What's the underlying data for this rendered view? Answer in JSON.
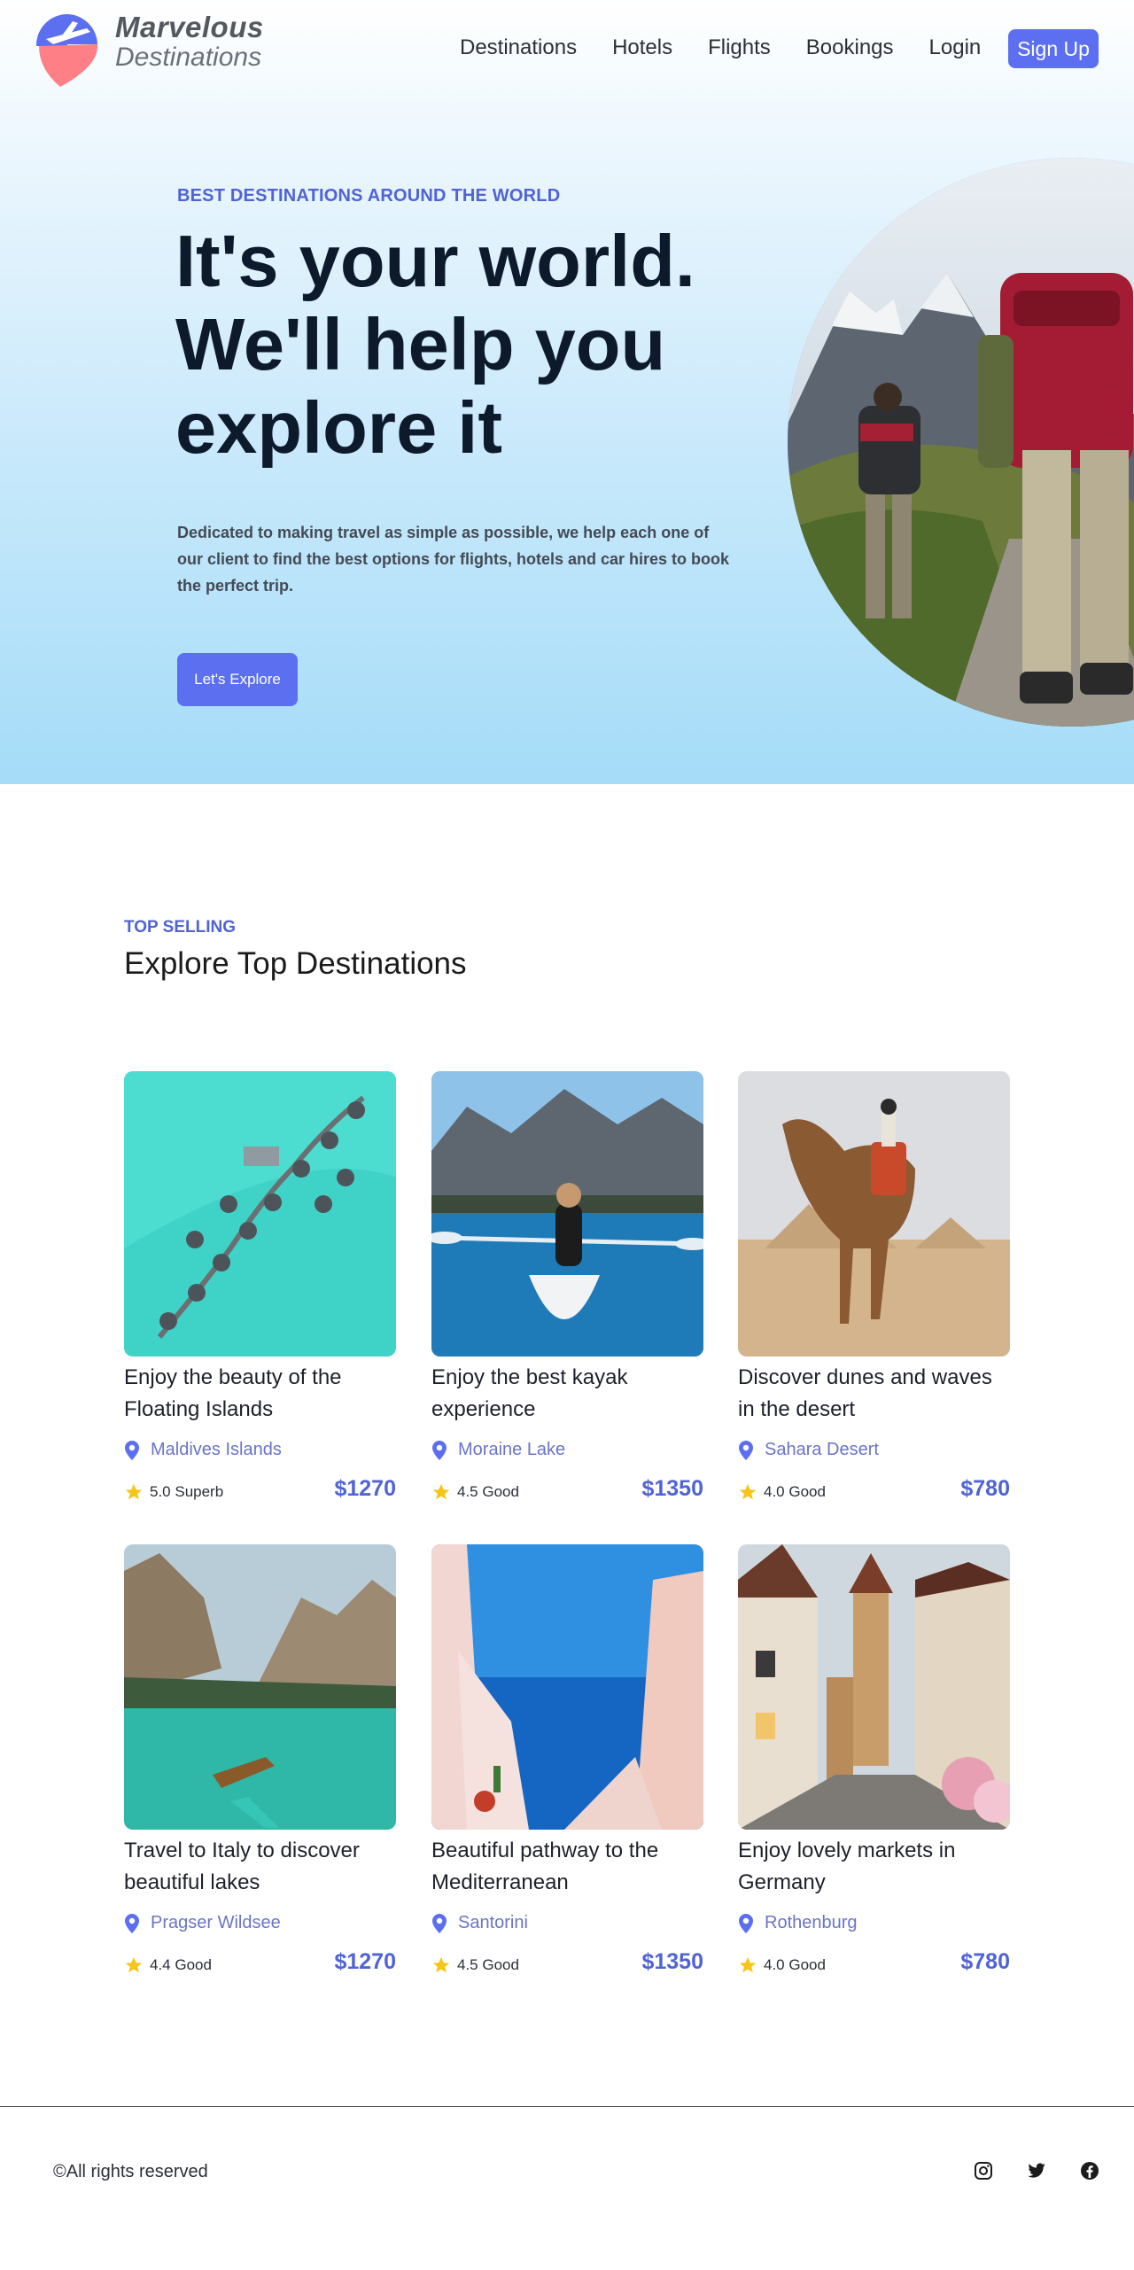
{
  "brand": {
    "line1": "Marvelous",
    "line2": "Destinations"
  },
  "nav": {
    "items": [
      "Destinations",
      "Hotels",
      "Flights",
      "Bookings",
      "Login"
    ],
    "signup": "Sign Up"
  },
  "hero": {
    "eyebrow": "BEST DESTINATIONS AROUND THE WORLD",
    "headline": "It's your world. We'll help you explore it",
    "text": "Dedicated to making travel as simple as possible, we help each one of our client to find the best options for flights, hotels and car hires to book the perfect trip.",
    "cta": "Let's Explore"
  },
  "section": {
    "eyebrow": "TOP SELLING",
    "title": "Explore Top Destinations"
  },
  "cards": [
    {
      "title": "Enjoy the beauty of the Floating Islands",
      "location": "Maldives Islands",
      "rating": "5.0 Superb",
      "price": "$1270"
    },
    {
      "title": "Enjoy the best kayak experience",
      "location": "Moraine Lake",
      "rating": "4.5 Good",
      "price": "$1350"
    },
    {
      "title": "Discover dunes and waves in the desert",
      "location": "Sahara Desert",
      "rating": "4.0 Good",
      "price": "$780"
    },
    {
      "title": "Travel to Italy to discover beautiful lakes",
      "location": "Pragser Wildsee",
      "rating": "4.4 Good",
      "price": "$1270"
    },
    {
      "title": "Beautiful pathway to the Mediterranean",
      "location": "Santorini",
      "rating": "4.5 Good",
      "price": "$1350"
    },
    {
      "title": "Enjoy lovely markets in Germany",
      "location": "Rothenburg",
      "rating": "4.0 Good",
      "price": "$780"
    }
  ],
  "footer": {
    "copyright": "©All rights reserved"
  },
  "colors": {
    "accent": "#5b6ff0",
    "accent_text": "#5063d6",
    "star": "#f5c518"
  }
}
